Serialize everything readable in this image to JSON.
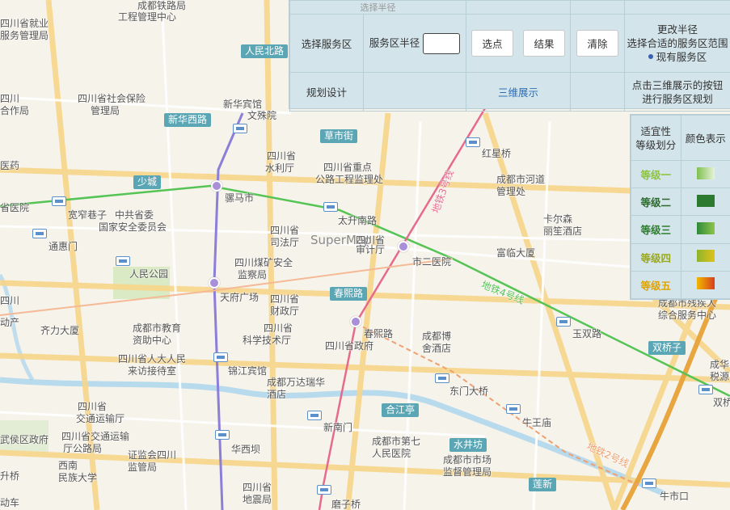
{
  "watermark": "SuperMap",
  "map_labels": {
    "chengdu_railway": "成都铁路局",
    "engineering_center": "工程管理中心",
    "employment": "四川省就业",
    "service_mgmt": "服务管理局",
    "sichuan_social_1": "四川省社会保险",
    "sichuan_social_2": "管理局",
    "sichuan_coop_1": "四川",
    "sichuan_coop_2": "合作局",
    "xinhua_hotel": "新华宾馆",
    "wenshu": "文殊院",
    "med": "医药",
    "hospital": "省医院",
    "water_1": "四川省",
    "water_2": "水利厅",
    "highway_1": "四川省重点",
    "highway_2": "公路工程监理处",
    "hongxing": "红星桥",
    "river_1": "成都市河道",
    "river_2": "管理处",
    "kuanzhai": "宽窄巷子",
    "national_security_1": "中共省委",
    "national_security_2": "国家安全委员会",
    "lumashi": "骡马市",
    "taisheng": "太升南路",
    "justice_1": "四川省",
    "justice_2": "司法厅",
    "audit_1": "四川省",
    "audit_2": "审计厅",
    "carlton_1": "卡尔森",
    "carlton_2": "丽笙酒店",
    "fulin": "富临大厦",
    "tonghui": "通惠门",
    "renmin_park": "人民公园",
    "coal_1": "四川煤矿安全",
    "coal_2": "监察局",
    "no2_hospital": "市二医院",
    "tianfu": "天府广场",
    "finance_1": "四川省",
    "finance_2": "财政厅",
    "qili": "齐力大厦",
    "edu_1": "成都市教育",
    "edu_2": "资助中心",
    "sci_1": "四川省",
    "sci_2": "科学技术厅",
    "chunxi": "春熙路",
    "museum_1": "成都博",
    "museum_2": "舍酒店",
    "govt": "四川省政府",
    "npc_1": "四川省人大人民",
    "npc_2": "来访接待室",
    "jinjiang": "锦江宾馆",
    "wanda_1": "成都万达瑞华",
    "wanda_2": "酒店",
    "dongmen": "东门大桥",
    "yushuang": "玉双路",
    "disabled_1": "成都市残疾人",
    "disabled_2": "综合服务中心",
    "tax_1": "成华",
    "tax_2": "税源",
    "shuang": "双桥",
    "transport_1": "四川省",
    "transport_2": "交通运输厅",
    "transport_3": "四川省交通运输",
    "transport_4": "厅公路局",
    "niuwang": "牛王庙",
    "xinnanmen": "新南门",
    "no7_hospital_1": "成都市第七",
    "no7_hospital_2": "人民医院",
    "market_1": "成都市市场",
    "market_2": "监督管理局",
    "daxian": "大厦",
    "wuhou_govt": "武侯区政府",
    "securities_1": "证监会四川",
    "securities_2": "监管局",
    "southwest": "西南",
    "minzu": "民族大学",
    "huaxi": "华西坝",
    "earthquake_1": "四川省",
    "earthquake_2": "地震局",
    "mozi": "磨子桥",
    "niushikou": "牛市口",
    "shengqiao": "升桥",
    "hushi": "动车",
    "sheng_left": "四川",
    "di_left": "动产"
  },
  "road_badges": {
    "renmin_north": "人民北路",
    "xinhua_west": "新华西路",
    "caoshi": "草市街",
    "shaocheng": "少城",
    "chunxi_road": "春熙路",
    "hejiang": "合江亭",
    "shuijing": "水井坊",
    "lianxin": "莲新",
    "shuangqiaozi": "双桥子"
  },
  "line_labels": {
    "line3": "地铁3号线",
    "line4": "地铁4号线",
    "line2": "地铁2号线"
  },
  "panel": {
    "top_cut_label": "选择半径",
    "row1_label": "选择服务区",
    "radius_label": "服务区半径",
    "radius_value": "",
    "select_point": "选点",
    "result": "结果",
    "clear": "清除",
    "hint_1": "更改半径",
    "hint_2": "选择合适的服务区范围",
    "existing": "现有服务区",
    "row2_label": "规划设计",
    "show_3d": "三维展示",
    "hint3d_1": "点击三维展示的按钮",
    "hint3d_2": "进行服务区规划"
  },
  "legend": {
    "header_1": "适宜性",
    "header_2": "等级划分",
    "header_color": "颜色表示",
    "grades": [
      {
        "label": "等级一",
        "text_color": "#8cc43f",
        "from": "#7fbf4f",
        "to": "#e8f3d8"
      },
      {
        "label": "等级二",
        "text_color": "#2a6a2a",
        "from": "#2b7a2f",
        "to": "#2b7a2f"
      },
      {
        "label": "等级三",
        "text_color": "#2f7d2f",
        "from": "#2f8a3a",
        "to": "#8ec54a"
      },
      {
        "label": "等级四",
        "text_color": "#9aa81e",
        "from": "#8fb42c",
        "to": "#e0c21a"
      },
      {
        "label": "等级五",
        "text_color": "#e0a400",
        "from": "#f2b800",
        "to": "#d7401c"
      }
    ]
  },
  "colors": {
    "panel_bg": "#d3e4ea",
    "metro_line3": "#e66a8c",
    "metro_line4": "#55c455",
    "metro_line1": "#8b7fd8"
  }
}
